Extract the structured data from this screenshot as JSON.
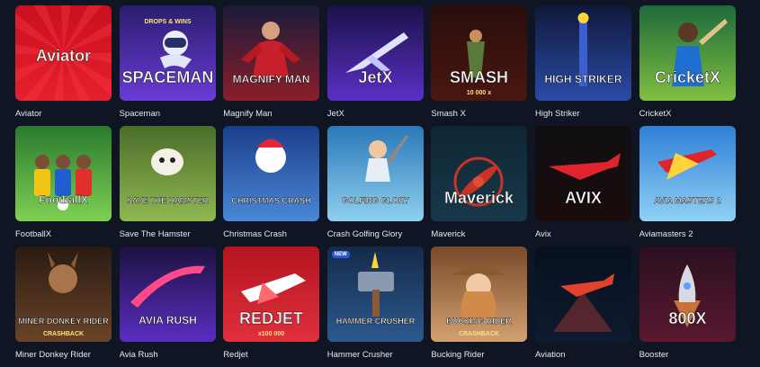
{
  "games": [
    {
      "name": "Aviator",
      "art_text": "Aviator",
      "colors": [
        "#c8101e",
        "#e5202e"
      ],
      "icon": "aviator-logo"
    },
    {
      "name": "Spaceman",
      "art_text": "SPACEMAN",
      "sub_text": "DROPS & WINS",
      "colors": [
        "#2a1d6e",
        "#6a3bd6"
      ],
      "icon": "astronaut"
    },
    {
      "name": "Magnify Man",
      "art_text": "MAGNIFY MAN",
      "colors": [
        "#1b1b3a",
        "#8a1e2a"
      ],
      "icon": "superhero"
    },
    {
      "name": "JetX",
      "art_text": "JetX",
      "colors": [
        "#1a1248",
        "#5b2fc7"
      ],
      "icon": "jet"
    },
    {
      "name": "Smash X",
      "art_text": "SMASH",
      "sub_text": "10 000 x",
      "colors": [
        "#2a0d0d",
        "#4a1710"
      ],
      "icon": "smash"
    },
    {
      "name": "High Striker",
      "art_text": "HIGH STRIKER",
      "colors": [
        "#10183a",
        "#2b4ba8"
      ],
      "icon": "high-striker"
    },
    {
      "name": "CricketX",
      "art_text": "CricketX",
      "colors": [
        "#1e6a3c",
        "#7fbf40"
      ],
      "icon": "cricket"
    },
    {
      "name": "FootballX",
      "art_text": "FootballX",
      "colors": [
        "#2a7a2e",
        "#7fd052"
      ],
      "icon": "football"
    },
    {
      "name": "Save The Hamster",
      "art_text": "SAVE THE HAMSTER",
      "colors": [
        "#4a6e2a",
        "#8fb851"
      ],
      "icon": "hamster"
    },
    {
      "name": "Christmas Crash",
      "art_text": "CHRISTMAS CRASH",
      "colors": [
        "#1b3f8a",
        "#4a88d8"
      ],
      "icon": "snowman"
    },
    {
      "name": "Crash Golfing Glory",
      "art_text": "GOLFING GLORY",
      "colors": [
        "#2a78b8",
        "#8fd0ef"
      ],
      "icon": "golfer"
    },
    {
      "name": "Maverick",
      "art_text": "Maverick",
      "colors": [
        "#0f2533",
        "#17394a"
      ],
      "icon": "propeller"
    },
    {
      "name": "Avix",
      "art_text": "AVIX",
      "colors": [
        "#0f0f12",
        "#1a0c0c"
      ],
      "icon": "plane"
    },
    {
      "name": "Aviamasters 2",
      "art_text": "AVIA MASTERS 2",
      "colors": [
        "#2f7fd6",
        "#8fd1f5"
      ],
      "icon": "red-plane"
    },
    {
      "name": "Miner Donkey Rider",
      "art_text": "MINER DONKEY RIDER",
      "sub_text": "CRASHBACK",
      "colors": [
        "#2a1b12",
        "#6a4428"
      ],
      "icon": "donkey"
    },
    {
      "name": "Avia Rush",
      "art_text": "AVIA RUSH",
      "colors": [
        "#1c1240",
        "#5a2dc2"
      ],
      "icon": "jet-trail"
    },
    {
      "name": "Redjet",
      "art_text": "REDJET",
      "sub_text": "x100 000",
      "colors": [
        "#b51420",
        "#e0303c"
      ],
      "icon": "red-jet"
    },
    {
      "name": "Hammer Crusher",
      "art_text": "HAMMER CRUSHER",
      "badge": "NEW",
      "colors": [
        "#142a4a",
        "#2c5a8e"
      ],
      "icon": "hammer"
    },
    {
      "name": "Bucking Rider",
      "art_text": "BUCKING RIDER",
      "sub_text": "CRASHBACK",
      "colors": [
        "#7a4a2a",
        "#d2a070"
      ],
      "icon": "cowgirl"
    },
    {
      "name": "Aviation",
      "art_text": "",
      "colors": [
        "#07101f",
        "#0e1a30"
      ],
      "icon": "aviation-plane"
    },
    {
      "name": "Booster",
      "art_text": "800X",
      "colors": [
        "#2a1020",
        "#5a1830"
      ],
      "icon": "rocket"
    }
  ]
}
